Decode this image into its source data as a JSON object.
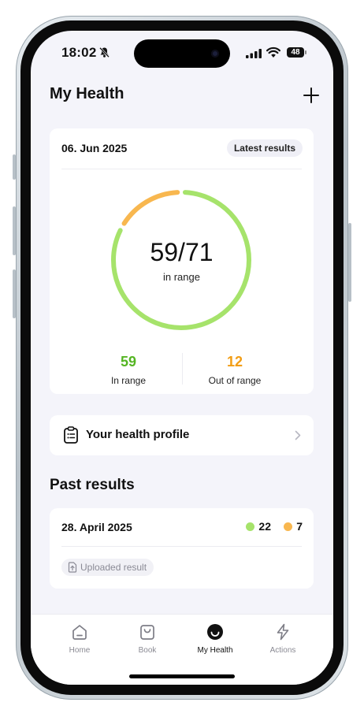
{
  "status_bar": {
    "time": "18:02",
    "battery": "48"
  },
  "header": {
    "title": "My Health",
    "add_icon": "plus-icon"
  },
  "summary": {
    "date": "06. Jun 2025",
    "badge": "Latest results",
    "ring_value": "59/71",
    "ring_caption": "in range",
    "in_range_fraction": 0.831,
    "in_range_count": "59",
    "in_range_label": "In range",
    "out_range_count": "12",
    "out_range_label": "Out of range",
    "colors": {
      "in_range": "#a6e36b",
      "out_range": "#f8b74f",
      "in_text": "#55b523",
      "out_text": "#f29d14"
    }
  },
  "profile": {
    "icon": "clipboard-icon",
    "label": "Your health profile"
  },
  "past_results": {
    "title": "Past results",
    "items": [
      {
        "date": "28. April 2025",
        "in_range": "22",
        "out_range": "7",
        "chip": "Uploaded result"
      }
    ]
  },
  "tab_bar": {
    "tabs": [
      {
        "label": "Home",
        "icon": "home-icon",
        "active": false
      },
      {
        "label": "Book",
        "icon": "bag-icon",
        "active": false
      },
      {
        "label": "My Health",
        "icon": "smile-icon",
        "active": true
      },
      {
        "label": "Actions",
        "icon": "bolt-icon",
        "active": false
      }
    ]
  }
}
